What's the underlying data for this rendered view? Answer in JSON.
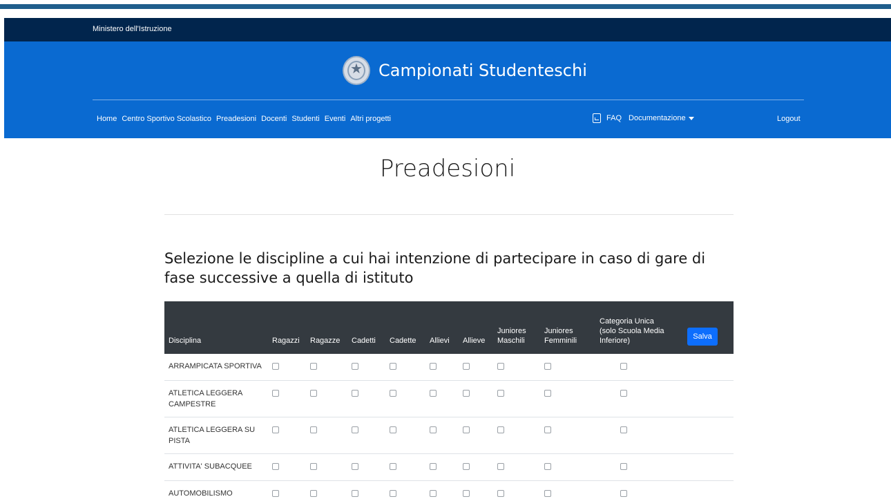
{
  "ministry": "Ministero dell'Istruzione",
  "brand": {
    "title": "Campionati Studenteschi",
    "emblem": "emblem-italy-icon"
  },
  "nav": {
    "items": [
      "Home",
      "Centro Sportivo Scolastico",
      "Preadesioni",
      "Docenti",
      "Studenti",
      "Eventi",
      "Altri progetti"
    ],
    "faq": "FAQ",
    "docs": "Documentazione",
    "logout": "Logout"
  },
  "page": {
    "title": "Preadesioni",
    "subtitle": "Selezione le discipline a cui hai intenzione di partecipare in caso di gare di fase successive a quella di istituto"
  },
  "table": {
    "headers": [
      "Disciplina",
      "Ragazzi",
      "Ragazze",
      "Cadetti",
      "Cadette",
      "Allievi",
      "Allieve",
      "Juniores Maschili",
      "Juniores Femminili",
      "Categoria Unica (solo Scuola Media Inferiore)"
    ],
    "save_label": "Salva",
    "rows": [
      "ARRAMPICATA SPORTIVA",
      "ATLETICA LEGGERA CAMPESTRE",
      "ATLETICA LEGGERA SU PISTA",
      "ATTIVITA' SUBACQUEE",
      "AUTOMOBILISMO"
    ]
  },
  "colors": {
    "header_dark": "#01254d",
    "header_blue": "#0a6ad1",
    "table_head": "#343a40",
    "button": "#0d6efd"
  }
}
